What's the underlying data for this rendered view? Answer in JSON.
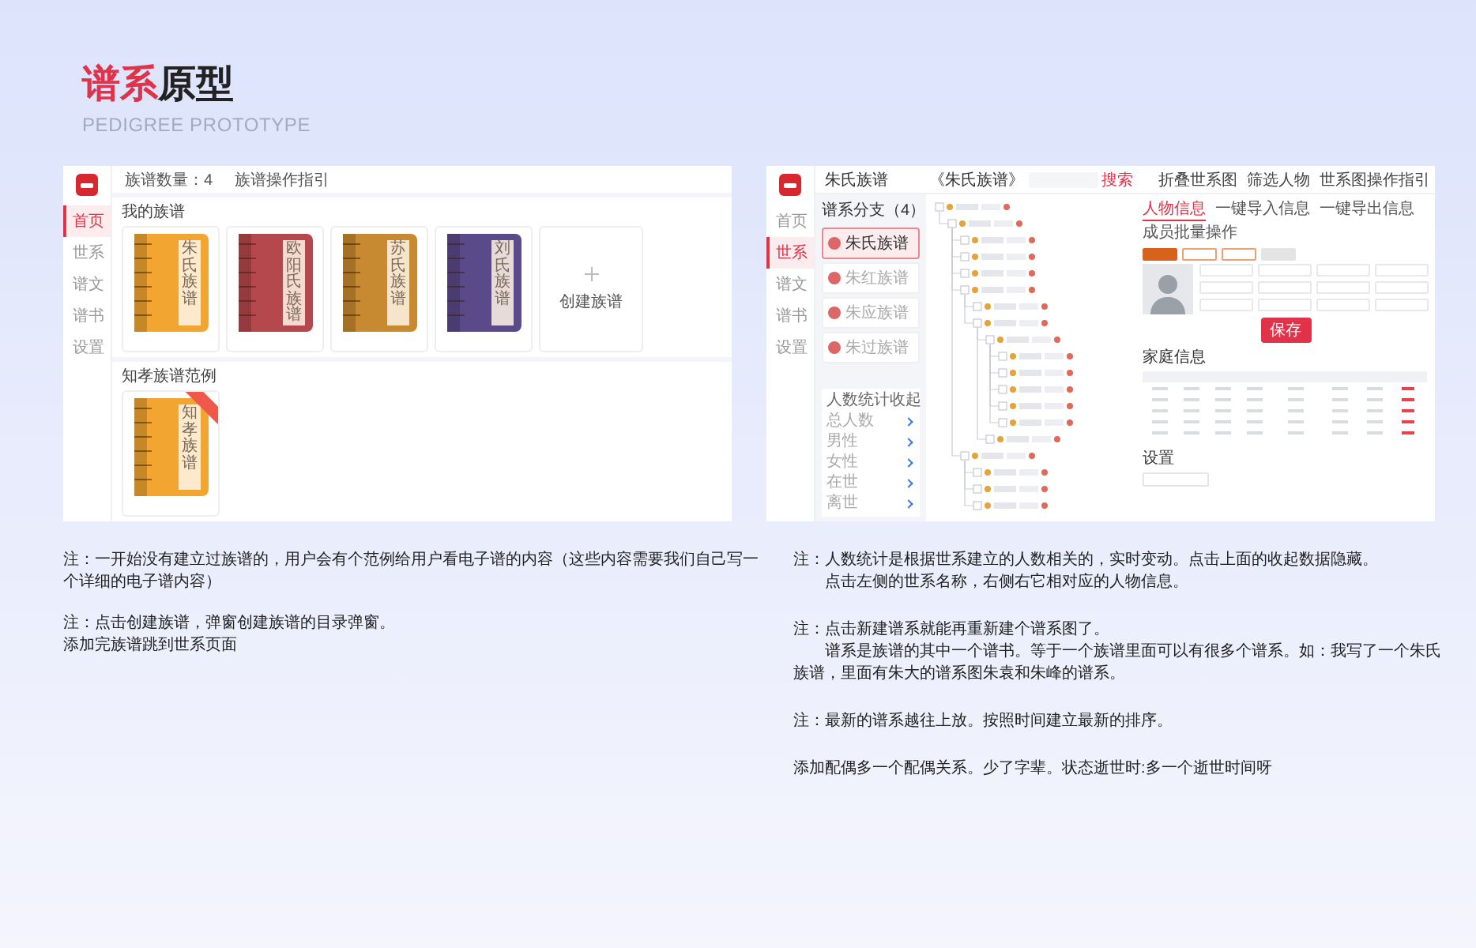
{
  "header": {
    "title_accent": "谱系",
    "title_rest": "原型",
    "subtitle": "PEDIGREE PROTOTYPE"
  },
  "left_screen": {
    "sidebar": [
      {
        "label": "首页",
        "selected": true
      },
      {
        "label": "世系",
        "selected": false
      },
      {
        "label": "谱文",
        "selected": false
      },
      {
        "label": "谱书",
        "selected": false
      },
      {
        "label": "设置",
        "selected": false
      }
    ],
    "toolbar": [
      "族谱数量：4",
      "族谱操作指引"
    ],
    "my_section": {
      "title": "我的族谱",
      "books": [
        {
          "title": "朱氏族谱",
          "color": "#f2a531"
        },
        {
          "title": "欧阳氏族谱",
          "color": "#b5484d"
        },
        {
          "title": "苏氏族谱",
          "color": "#c88a30"
        },
        {
          "title": "刘氏族谱",
          "color": "#5b4a8a"
        }
      ],
      "create_label": "创建族谱"
    },
    "example_section": {
      "title": "知孝族谱范例",
      "books": [
        {
          "title": "知孝族谱",
          "color": "#f2a531"
        }
      ]
    }
  },
  "right_screen": {
    "sidebar": [
      {
        "label": "首页",
        "selected": false
      },
      {
        "label": "世系",
        "selected": true
      },
      {
        "label": "谱文",
        "selected": false
      },
      {
        "label": "谱书",
        "selected": false
      },
      {
        "label": "设置",
        "selected": false
      }
    ],
    "family_title": "朱氏族谱",
    "tree_title": "《朱氏族谱》",
    "search_button": "搜索",
    "actions": [
      "折叠世系图",
      "筛选人物",
      "世系图操作指引"
    ],
    "branches_title": "谱系分支（4）",
    "branches": [
      {
        "name": "朱氏族谱",
        "selected": true
      },
      {
        "name": "朱红族谱",
        "selected": false
      },
      {
        "name": "朱应族谱",
        "selected": false
      },
      {
        "name": "朱过族谱",
        "selected": false
      }
    ],
    "stats": {
      "title": "人数统计",
      "toggle": "收起",
      "rows": [
        "总人数",
        "男性",
        "女性",
        "在世",
        "离世"
      ]
    },
    "tabs": [
      {
        "label": "人物信息",
        "selected": true
      },
      {
        "label": "一键导入信息",
        "selected": false
      },
      {
        "label": "一键导出信息",
        "selected": false
      },
      {
        "label": "成员批量操作",
        "selected": false
      }
    ],
    "save_button": "保存",
    "family_info_title": "家庭信息",
    "settings_title": "设置"
  },
  "notes_left": [
    [
      {
        "text": "注：一开始没有建立过族谱的，用户会有个范例给用户看电子谱的内容（这些内容需要我们自己写一个详细的电子谱内容）",
        "indent": false
      }
    ],
    [
      {
        "text": "注：点击创建族谱，弹窗创建族谱的目录弹窗。",
        "indent": false
      },
      {
        "text": "添加完族谱跳到世系页面",
        "indent": false
      }
    ]
  ],
  "notes_right": [
    [
      {
        "text": "注：人数统计是根据世系建立的人数相关的，实时变动。点击上面的收起数据隐藏。",
        "indent": false
      },
      {
        "text": "点击左侧的世系名称，右侧右它相对应的人物信息。",
        "indent": true
      }
    ],
    [
      {
        "text": "注：点击新建谱系就能再重新建个谱系图了。",
        "indent": false
      },
      {
        "text": "谱系是族谱的其中一个谱书。等于一个族谱里面可以有很多个谱系。如：我写了一个朱氏族谱，里面有朱大的谱系图朱袁和朱峰的谱系。",
        "indent": true
      }
    ],
    [
      {
        "text": "注：最新的谱系越往上放。按照时间建立最新的排序。",
        "indent": false
      }
    ],
    [
      {
        "text": "添加配偶多一个配偶关系。少了字辈。状态逝世时:多一个逝世时间呀",
        "indent": false
      }
    ]
  ]
}
